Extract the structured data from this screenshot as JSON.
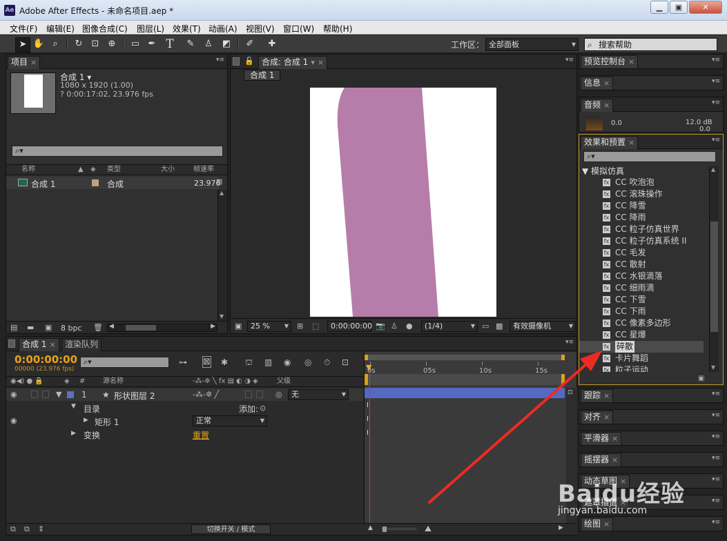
{
  "window": {
    "app_icon": "Ae",
    "title": "Adobe After Effects - 未命名项目.aep *",
    "controls": [
      "minimize-icon",
      "maximize-icon",
      "close-icon"
    ]
  },
  "menu": [
    "文件(F)",
    "编辑(E)",
    "图像合成(C)",
    "图层(L)",
    "效果(T)",
    "动画(A)",
    "视图(V)",
    "窗口(W)",
    "帮助(H)"
  ],
  "toolbar": {
    "workspace_label": "工作区：",
    "workspace_value": "全部面板",
    "search_help": "搜索帮助",
    "tools": [
      "selection-icon",
      "hand-icon",
      "zoom-icon",
      "rotate-icon",
      "camera-orbit-icon",
      "pan-behind-icon",
      "rectangle-icon",
      "pen-icon",
      "text-icon",
      "brush-icon",
      "clone-stamp-icon",
      "eraser-icon",
      "roto-brush-icon",
      "puppet-pin-icon"
    ],
    "text_tool_glyph": "T"
  },
  "project_panel": {
    "tab": "项目",
    "comp_name": "合成 1",
    "comp_size": "1080 x 1920 (1.00)",
    "comp_duration": "? 0:00:17:02, 23.976 fps",
    "columns": [
      "名称",
      "类型",
      "大小",
      "帧速率"
    ],
    "rows": [
      {
        "name": "合成 1",
        "type": "合成",
        "size": "",
        "fps": "23.976"
      }
    ],
    "bpc": "8 bpc"
  },
  "composition_panel": {
    "tab": "合成: 合成 1",
    "subtab": "合成 1",
    "zoom": "25 %",
    "timecode": "0:00:00:00",
    "resolution": "(1/4)",
    "camera": "有效摄像机",
    "shape_color": "#b67daa"
  },
  "right_panels": {
    "preview": "预览控制台",
    "info": "信息",
    "audio": "音频",
    "audio_left_value": "0.0",
    "audio_right_value": "12.0 dB",
    "audio_right_value2": "0.0",
    "effects_tab": "效果和预置",
    "category": "模拟仿真",
    "effects": [
      "CC 吹泡泡",
      "CC 滚珠操作",
      "CC 降雪",
      "CC 降雨",
      "CC 粒子仿真世界",
      "CC 粒子仿真系统 II",
      "CC 毛发",
      "CC 散射",
      "CC 水银滴落",
      "CC 细雨滴",
      "CC 下雪",
      "CC 下雨",
      "CC 像素多边形",
      "CC 星爆",
      "碎散",
      "卡片舞蹈",
      "粒子运动"
    ],
    "selected_effect_index": 14,
    "collapsed": [
      "跟踪",
      "对齐",
      "平滑器",
      "摇摆器",
      "动态草图",
      "遮罩插值",
      "绘图"
    ]
  },
  "timeline": {
    "tab": "合成 1",
    "render_tab": "渲染队列",
    "timecode": "0:00:00:00",
    "frame_info": "00000 (23.976 fps)",
    "ruler": [
      "0s",
      "05s",
      "10s",
      "15s"
    ],
    "col_name": "源名称",
    "col_parent": "父级",
    "layer_num": "1",
    "layer_name": "形状图层 2",
    "parent_value": "无",
    "layer_color": "#5b6fc8",
    "contents": "目录",
    "add_label": "添加:",
    "rect": "矩形 1",
    "blend": "正常",
    "transform": "变换",
    "reset": "重置",
    "toggle": "切换开关 / 模式"
  },
  "watermark": {
    "logo": "Baidu经验",
    "url": "jingyan.baidu.com"
  }
}
